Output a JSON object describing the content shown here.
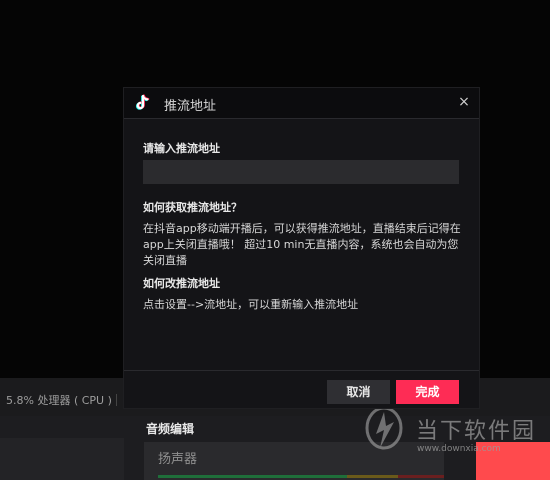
{
  "dialog": {
    "title": "推流地址",
    "close_glyph": "×",
    "field_label": "请输入推流地址",
    "input_value": "",
    "input_placeholder": "",
    "section1_heading": "如何获取推流地址？",
    "section1_text": "在抖音app移动端开播后，可以获得推流地址，直播结束后记得在app上关闭直播哦！ 超过10 min无直播内容，系统也会自动为您关闭直播",
    "section2_heading": "如何改推流地址",
    "section2_text": "点击设置-->流地址，可以重新输入推流地址",
    "cancel_label": "取消",
    "done_label": "完成",
    "logo_icon": "douyin-logo-icon",
    "accent_color": "#fe2c55"
  },
  "background": {
    "status_text": "5.8% 处理器 ( CPU )",
    "audio_section_title": "音频编辑",
    "speaker_label": "扬声器"
  },
  "watermark": {
    "text": "当下软件园",
    "url": "www.downxia.com"
  }
}
